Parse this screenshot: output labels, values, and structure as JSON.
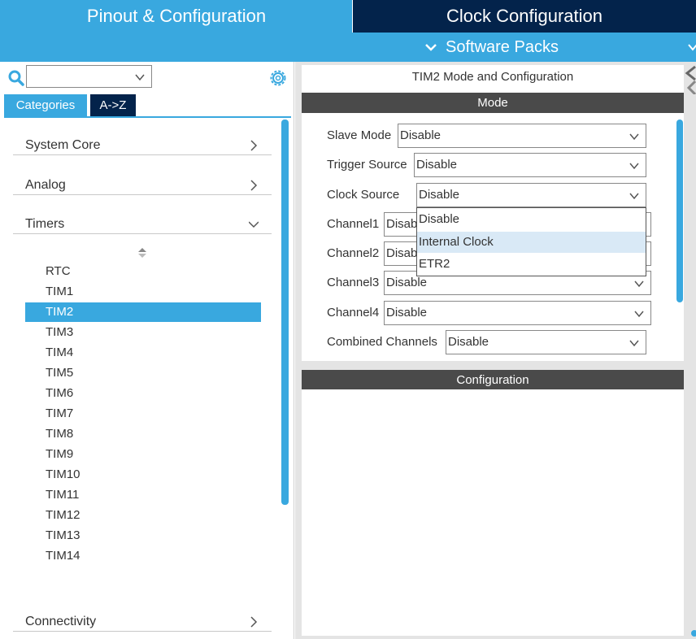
{
  "top_tabs": {
    "pinout": "Pinout & Configuration",
    "clock": "Clock Configuration",
    "software_packs": "Software Packs"
  },
  "left": {
    "search_value": "",
    "tabs": {
      "categories": "Categories",
      "az": "A->Z"
    },
    "sections": {
      "system_core": "System Core",
      "analog": "Analog",
      "timers": "Timers",
      "connectivity": "Connectivity"
    },
    "timers": [
      "RTC",
      "TIM1",
      "TIM2",
      "TIM3",
      "TIM4",
      "TIM5",
      "TIM6",
      "TIM7",
      "TIM8",
      "TIM9",
      "TIM10",
      "TIM11",
      "TIM12",
      "TIM13",
      "TIM14"
    ],
    "selected_timer": "TIM2"
  },
  "right": {
    "title": "TIM2 Mode and Configuration",
    "mode_header": "Mode",
    "config_header": "Configuration",
    "fields": {
      "slave_mode": {
        "label": "Slave Mode",
        "value": "Disable"
      },
      "trigger_source": {
        "label": "Trigger Source",
        "value": "Disable"
      },
      "clock_source": {
        "label": "Clock Source",
        "value": "Disable"
      },
      "channel1": {
        "label": "Channel1",
        "value": "Disable"
      },
      "channel2": {
        "label": "Channel2",
        "value": "Disable"
      },
      "channel3": {
        "label": "Channel3",
        "value": "Disable"
      },
      "channel4": {
        "label": "Channel4",
        "value": "Disable"
      },
      "combined_channels": {
        "label": "Combined Channels",
        "value": "Disable"
      }
    },
    "clock_source_options": [
      "Disable",
      "Internal Clock",
      "ETR2"
    ],
    "highlighted_option": "Internal Clock"
  },
  "colors": {
    "accent": "#39a8df",
    "dark_navy": "#03234b",
    "header_gray": "#4a4a4a",
    "hover": "#d9e9f6"
  }
}
